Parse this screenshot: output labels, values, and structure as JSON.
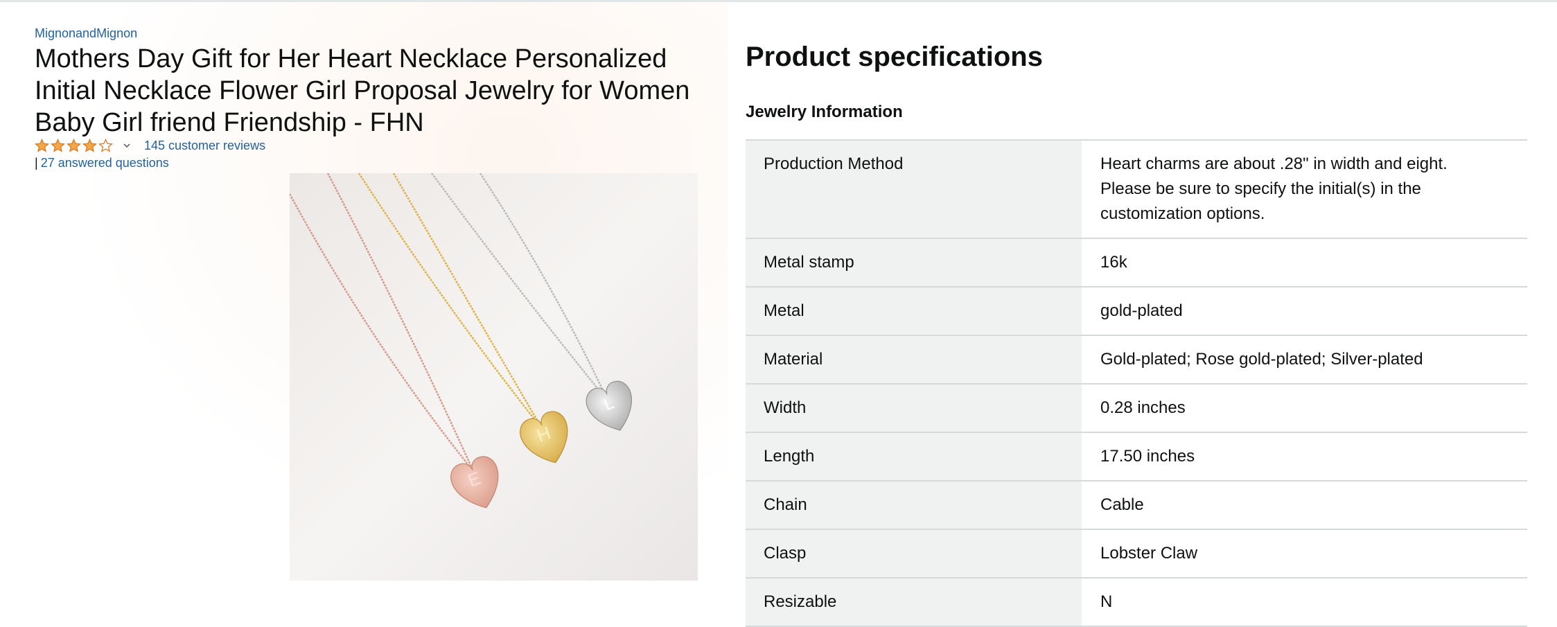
{
  "product": {
    "brand": "MignonandMignon",
    "title": "Mothers Day Gift for Her Heart Necklace Personalized Initial Necklace Flower Girl Proposal Jewelry for Women Baby Girl friend Friendship - FHN",
    "rating": 4,
    "rating_max": 5,
    "reviews_label": "145 customer reviews",
    "questions_separator": "|",
    "questions_label": "27 answered questions",
    "image_letters": [
      "E",
      "H",
      "L"
    ]
  },
  "specs": {
    "title": "Product specifications",
    "section": "Jewelry Information",
    "rows": [
      {
        "label": "Production Method",
        "value": "Heart charms are about .28\" in width and eight. Please be sure to specify the initial(s) in the customization options."
      },
      {
        "label": "Metal stamp",
        "value": "16k"
      },
      {
        "label": "Metal",
        "value": "gold-plated"
      },
      {
        "label": "Material",
        "value": "Gold-plated; Rose gold-plated; Silver-plated"
      },
      {
        "label": "Width",
        "value": "0.28 inches"
      },
      {
        "label": "Length",
        "value": "17.50 inches"
      },
      {
        "label": "Chain",
        "value": "Cable"
      },
      {
        "label": "Clasp",
        "value": "Lobster Claw"
      },
      {
        "label": "Resizable",
        "value": "N"
      }
    ]
  },
  "colors": {
    "link": "#2162a1",
    "star_fill": "#f3a847",
    "star_stroke": "#de7921",
    "table_label_bg": "#f0f2f2",
    "table_border": "#d5d9d9",
    "rose_gold": "#e3a99a",
    "gold": "#e7c15e",
    "silver": "#c9c9c9"
  }
}
